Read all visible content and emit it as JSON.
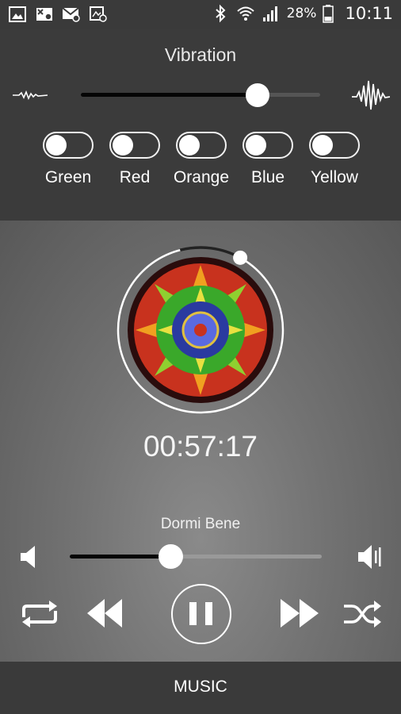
{
  "status_bar": {
    "notification_icons": [
      "gallery-icon",
      "missed-call-icon",
      "email-icon",
      "mms-icon"
    ],
    "battery": "28%",
    "time": "10:11"
  },
  "vibration": {
    "title": "Vibration",
    "level": 0.74
  },
  "color_toggles": [
    {
      "label": "Green",
      "on": false
    },
    {
      "label": "Red",
      "on": false
    },
    {
      "label": "Orange",
      "on": false
    },
    {
      "label": "Blue",
      "on": false
    },
    {
      "label": "Yellow",
      "on": false
    }
  ],
  "player": {
    "elapsed": "00:57:17",
    "track_title": "Dormi Bene",
    "ring_progress": 0.08,
    "volume": 0.4
  },
  "bottom_nav": {
    "label": "MUSIC"
  },
  "colors": {
    "panel_bg": "#3b3b3b",
    "slider_fill": "#050505",
    "accent": "#ffffff"
  }
}
